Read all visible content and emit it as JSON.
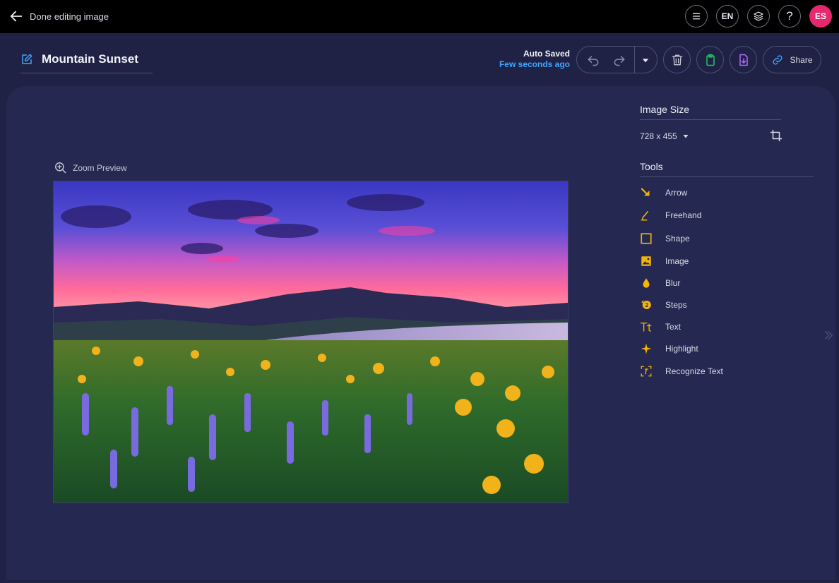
{
  "topbar": {
    "back_label": "Done editing image",
    "language": "EN",
    "help": "?",
    "avatar_initials": "ES",
    "avatar_color": "#e5286f"
  },
  "header": {
    "title": "Mountain Sunset",
    "autosave_status": "Auto Saved",
    "autosave_time": "Few seconds ago",
    "share_label": "Share"
  },
  "canvas": {
    "zoom_label": "Zoom Preview",
    "image_alt": "Mountain sunset over lake with lupine and balsamroot wildflowers"
  },
  "image_size": {
    "heading": "Image Size",
    "value": "728 x 455"
  },
  "tools": {
    "heading": "Tools",
    "items": [
      {
        "label": "Arrow",
        "icon": "arrow-icon"
      },
      {
        "label": "Freehand",
        "icon": "freehand-icon"
      },
      {
        "label": "Shape",
        "icon": "shape-icon"
      },
      {
        "label": "Image",
        "icon": "image-icon"
      },
      {
        "label": "Blur",
        "icon": "blur-icon"
      },
      {
        "label": "Steps",
        "icon": "steps-icon"
      },
      {
        "label": "Text",
        "icon": "text-icon"
      },
      {
        "label": "Highlight",
        "icon": "highlight-icon"
      },
      {
        "label": "Recognize Text",
        "icon": "recognize-text-icon"
      }
    ]
  },
  "colors": {
    "accent_tools": "#f5b40a",
    "accent_blue": "#3fa6ff",
    "accent_green": "#22c55e",
    "accent_purple": "#b36bff"
  }
}
